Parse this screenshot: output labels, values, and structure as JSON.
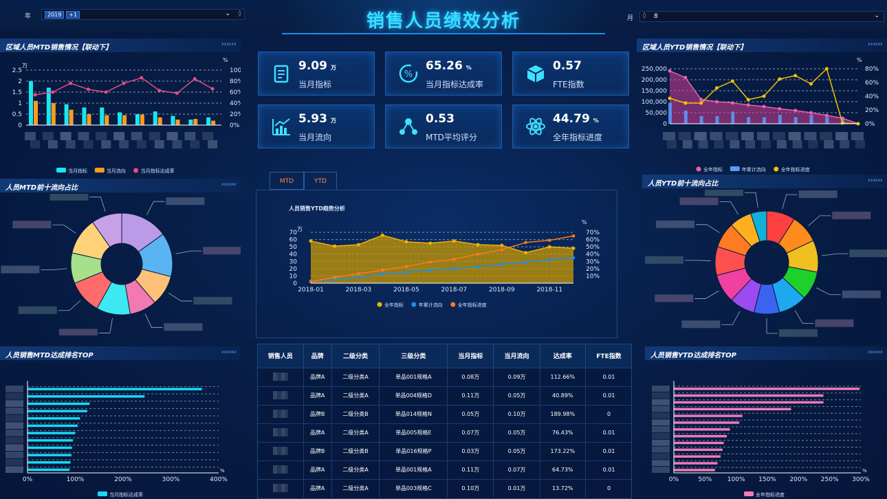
{
  "header": {
    "title": "销售人员绩效分析",
    "year_label": "年",
    "year_value": "2019",
    "year_more": "+1",
    "month_label": "月",
    "month_value": "8"
  },
  "kpis": [
    {
      "value": "9.09",
      "unit": "万",
      "label": "当月指标",
      "icon": "clipboard-icon"
    },
    {
      "value": "65.26",
      "unit": "%",
      "label": "当月指标达成率",
      "icon": "percent-icon"
    },
    {
      "value": "0.57",
      "unit": "",
      "label": "FTE指数",
      "icon": "cube-icon"
    },
    {
      "value": "5.93",
      "unit": "万",
      "label": "当月流向",
      "icon": "chart-up-icon"
    },
    {
      "value": "0.53",
      "unit": "",
      "label": "MTD平均评分",
      "icon": "molecule-icon"
    },
    {
      "value": "44.79",
      "unit": "%",
      "label": "全年指标进度",
      "icon": "atom-icon"
    }
  ],
  "sections": {
    "mtd_region": "区域人员MTD销售情况【联动下】",
    "ytd_region": "区域人员YTD销售情况【联动下】",
    "mtd_top10": "人员MTD前十流向占比",
    "ytd_top10": "人员YTD前十流向占比",
    "mtd_rank": "人员销售MTD达成排名TOP",
    "ytd_rank": "人员销售YTD达成排名TOP",
    "arrows": "› › › › › ›"
  },
  "tabs": {
    "mtd": "MTD",
    "ytd": "YTD"
  },
  "trend_title": "人员销售YTD趋势分析",
  "table": {
    "headers": [
      "销售人员",
      "品牌",
      "二级分类",
      "三级分类",
      "当月指标",
      "当月流向",
      "达成率",
      "FTE指数"
    ],
    "rows": [
      [
        "",
        "品牌A",
        "二级分类A",
        "单品001规格A",
        "0.08万",
        "0.09万",
        "112.66%",
        "0.01"
      ],
      [
        "",
        "品牌A",
        "二级分类A",
        "单品004规格D",
        "0.11万",
        "0.05万",
        "40.89%",
        "0.01"
      ],
      [
        "",
        "品牌B",
        "二级分类B",
        "单品014规格N",
        "0.05万",
        "0.10万",
        "189.98%",
        "0"
      ],
      [
        "",
        "品牌A",
        "二级分类A",
        "单品005规格E",
        "0.07万",
        "0.05万",
        "76.43%",
        "0.01"
      ],
      [
        "",
        "品牌B",
        "二级分类B",
        "单品016规格P",
        "0.03万",
        "0.05万",
        "173.22%",
        "0.01"
      ],
      [
        "",
        "品牌A",
        "二级分类A",
        "单品001规格A",
        "0.11万",
        "0.07万",
        "64.73%",
        "0.01"
      ],
      [
        "",
        "品牌A",
        "二级分类A",
        "单品003规格C",
        "0.10万",
        "0.01万",
        "13.72%",
        "0"
      ]
    ]
  },
  "chart_data": [
    {
      "id": "mtd_region",
      "type": "bar",
      "y_unit": "万",
      "y2_unit": "%",
      "ylim": [
        0,
        2.5
      ],
      "y2lim": [
        0,
        100
      ],
      "yticks": [
        "2.5",
        "2",
        "1.5",
        "1",
        "0.5",
        "0"
      ],
      "y2ticks": [
        "100%",
        "80%",
        "60%",
        "40%",
        "20%",
        "0%"
      ],
      "series": [
        {
          "name": "当月指标",
          "color": "#19e6f2",
          "values": [
            2.0,
            1.7,
            0.95,
            0.8,
            0.8,
            0.58,
            0.5,
            0.62,
            0.42,
            0.25,
            0.35
          ]
        },
        {
          "name": "当月流向",
          "color": "#ff9a1f",
          "values": [
            1.1,
            1.0,
            0.7,
            0.5,
            0.45,
            0.45,
            0.48,
            0.35,
            0.25,
            0.28,
            0.2
          ]
        },
        {
          "name": "当月指标达成率",
          "color": "#e84b87",
          "values": [
            55,
            60,
            76,
            65,
            60,
            76,
            86,
            63,
            58,
            84,
            66
          ]
        }
      ]
    },
    {
      "id": "ytd_region",
      "type": "area",
      "yticks": [
        "250,000",
        "200,000",
        "150,000",
        "100,000",
        "50,000",
        "0"
      ],
      "y2ticks": [
        "80%",
        "60%",
        "40%",
        "20%",
        "0%"
      ],
      "y2_unit": "%",
      "ylim": [
        0,
        250000
      ],
      "y2lim": [
        0,
        80
      ],
      "series": [
        {
          "name": "全年指标",
          "color": "#ee5fb0",
          "values": [
            240000,
            210000,
            110000,
            100000,
            95000,
            85000,
            78000,
            68000,
            60000,
            50000,
            38000,
            25000,
            0
          ]
        },
        {
          "name": "年累计流向",
          "color": "#5a9bff",
          "values": [
            95000,
            60000,
            35000,
            35000,
            55000,
            30000,
            30000,
            40000,
            30000,
            40000,
            30000,
            30000,
            0
          ]
        },
        {
          "name": "全年指标进度",
          "color": "#f2c300",
          "values": [
            37,
            30,
            30,
            52,
            62,
            35,
            40,
            65,
            70,
            58,
            80,
            1,
            0
          ]
        }
      ]
    },
    {
      "id": "mtd_pie",
      "type": "pie",
      "colors": [
        "#bb9ae8",
        "#5ab4f2",
        "#ffc07a",
        "#f27ab0",
        "#3ee8f0",
        "#ff6b6b",
        "#a6e08a",
        "#ffd27a",
        "#c8a0e8"
      ],
      "values": [
        14,
        13,
        9,
        8,
        10,
        10,
        9,
        11,
        9
      ]
    },
    {
      "id": "ytd_pie",
      "type": "pie",
      "colors": [
        "#ff4040",
        "#ff8c1a",
        "#f0c020",
        "#1ed12a",
        "#1ea8f0",
        "#3a63f0",
        "#9b4bf0",
        "#f040a0",
        "#ff5050",
        "#ff7a20",
        "#ffb020",
        "#12b0d8"
      ],
      "values": [
        9,
        9,
        10,
        9,
        9,
        8,
        8,
        9,
        9,
        8,
        7,
        5
      ]
    },
    {
      "id": "ytd_trend",
      "type": "area",
      "x": [
        "2018-01",
        "2018-02",
        "2018-03",
        "2018-04",
        "2018-05",
        "2018-06",
        "2018-07",
        "2018-08",
        "2018-09",
        "2018-10",
        "2018-11",
        "2018-12"
      ],
      "xticks": [
        "2018-01",
        "2018-03",
        "2018-05",
        "2018-07",
        "2018-09",
        "2018-11"
      ],
      "y_unit": "万",
      "y2_unit": "%",
      "ylim": [
        0,
        70
      ],
      "y2lim": [
        0,
        70
      ],
      "yticks": [
        "70",
        "60",
        "50",
        "40",
        "30",
        "20",
        "10",
        "0"
      ],
      "y2ticks": [
        "70%",
        "60%",
        "50%",
        "40%",
        "30%",
        "20%",
        "10%"
      ],
      "series": [
        {
          "name": "全年指标",
          "color": "#f2b200",
          "values": [
            58,
            51,
            53,
            66,
            57,
            55,
            58,
            53,
            52,
            42,
            50,
            48
          ]
        },
        {
          "name": "年累计流向",
          "color": "#1a8ff0",
          "values": [
            3,
            5,
            8,
            13,
            15,
            18,
            20,
            23,
            26,
            29,
            32,
            35
          ]
        },
        {
          "name": "全年指标进度",
          "color": "#ff7a1a",
          "values": [
            2,
            8,
            13,
            18,
            23,
            29,
            33,
            40,
            46,
            56,
            59,
            65
          ]
        }
      ]
    },
    {
      "id": "mtd_rank",
      "type": "bar",
      "orientation": "horizontal",
      "xticks": [
        "0%",
        "100%",
        "200%",
        "300%",
        "400%"
      ],
      "xlim": [
        0,
        400
      ],
      "series": [
        {
          "name": "当月指标达成率",
          "color": "#19d8f2",
          "values": [
            365,
            245,
            130,
            125,
            110,
            105,
            100,
            95,
            93,
            92,
            90,
            88
          ]
        }
      ]
    },
    {
      "id": "ytd_rank",
      "type": "bar",
      "orientation": "horizontal",
      "xticks": [
        "0%",
        "50%",
        "100%",
        "150%",
        "200%",
        "250%",
        "300%"
      ],
      "xlim": [
        0,
        300
      ],
      "series": [
        {
          "name": "全年指标进度",
          "color": "#f07ab8",
          "values": [
            298,
            240,
            240,
            188,
            110,
            105,
            90,
            85,
            80,
            78,
            75,
            70,
            66
          ]
        }
      ]
    }
  ]
}
